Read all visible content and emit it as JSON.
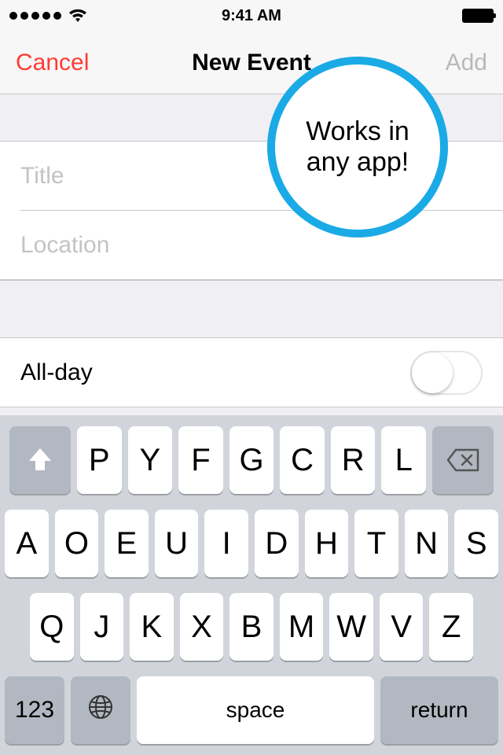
{
  "status": {
    "time": "9:41 AM"
  },
  "nav": {
    "cancel": "Cancel",
    "title": "New Event",
    "add": "Add"
  },
  "fields": {
    "title_placeholder": "Title",
    "title_value": "",
    "location_placeholder": "Location",
    "location_value": ""
  },
  "allday": {
    "label": "All-day"
  },
  "promo": {
    "text": "Works in any app!"
  },
  "keyboard": {
    "row1": [
      "P",
      "Y",
      "F",
      "G",
      "C",
      "R",
      "L"
    ],
    "row2": [
      "A",
      "O",
      "E",
      "U",
      "I",
      "D",
      "H",
      "T",
      "N",
      "S"
    ],
    "row3": [
      "Q",
      "J",
      "K",
      "X",
      "B",
      "M",
      "W",
      "V",
      "Z"
    ],
    "numbers": "123",
    "space": "space",
    "return": "return"
  }
}
